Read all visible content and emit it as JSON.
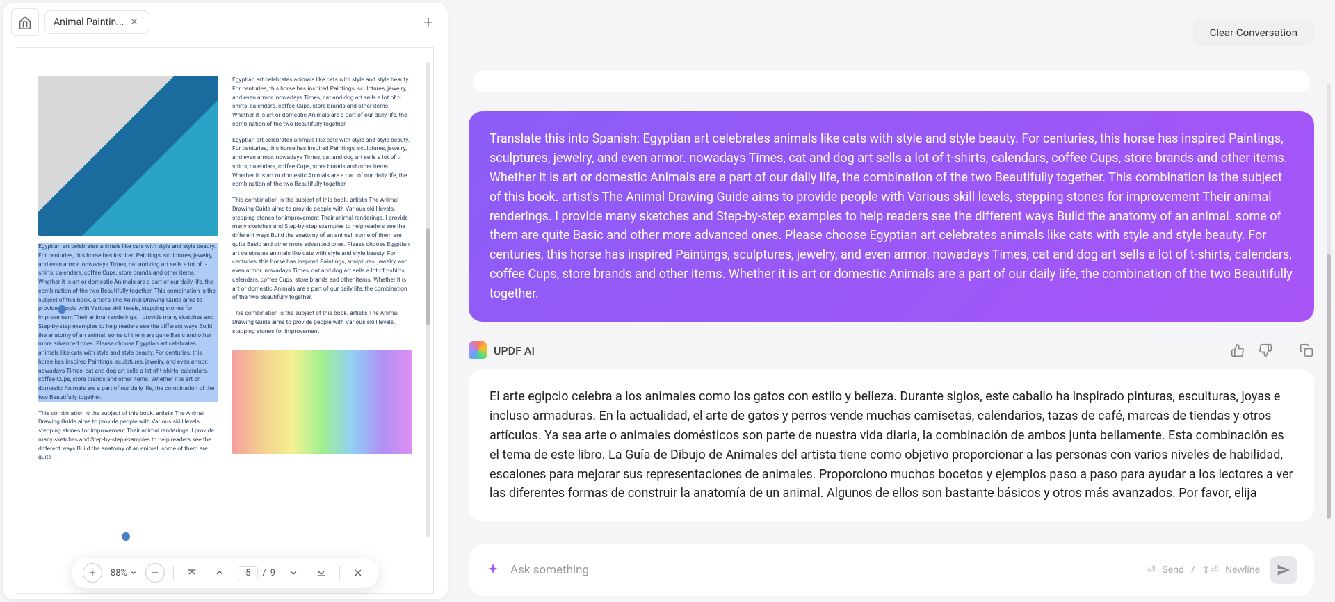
{
  "tab": {
    "title": "Animal Paintin...",
    "close_aria": "Close tab"
  },
  "add_tab_aria": "New tab",
  "toolbar": {
    "zoom": "88%",
    "page_current": "5",
    "page_sep": "/",
    "page_total": "9"
  },
  "doc_body": {
    "p1": "Egyptian art celebrates animals like cats with style and style beauty. For centuries, this horse has inspired Paintings, sculptures, jewelry, and even armor. nowadays Times, cat and dog art sells a lot of t-shirts, calendars, coffee Cups, store brands and other items. Whether it is art or domestic Animals are a part of our daily life, the combination of the two Beautifully together.",
    "p2": "Egyptian art celebrates animals like cats with style and style beauty. For centuries, this horse has inspired Paintings, sculptures, jewelry, and even armor. nowadays Times, cat and dog art sells a lot of t-shirts, calendars, coffee Cups, store brands and other items. Whether it is art or domestic Animals are a part of our daily life, the combination of the two Beautifully together. This combination is the subject of this book. artist's The Animal Drawing Guide aims to provide people with Various skill levels, stepping stones for improvement Their animal renderings. I provide many sketches and Step-by-step examples to help readers see the different ways Build the anatomy of an animal. some of them are quite Basic and other more advanced ones. Please choose Egyptian art celebrates animals like cats with style and style beauty. For centuries, this horse has inspired Paintings, sculptures, jewelry, and even armor. nowadays Times, cat and dog art sells a lot of t-shirts, calendars, coffee Cups, store brands and other items. Whether it is art or domestic Animals are a part of our daily life, the combination of the two Beautifully together.",
    "p3": "This combination is the subject of this book. artist's The Animal Drawing Guide aims to provide people with Various skill levels, stepping stones for improvement Their animal renderings. I provide many sketches and Step-by-step examples to help readers see the different ways Build the anatomy of an animal. some of them are quite",
    "p4": "Egyptian art celebrates animals like cats with style and style beauty. For centuries, this horse has inspired Paintings, sculptures, jewelry, and even armor. nowadays Times, cat and dog art sells a lot of t-shirts, calendars, coffee Cups, store brands and other items. Whether it is art or domestic Animals are a part of our daily life, the combination of the two Beautifully together.",
    "p5": "This combination is the subject of this book. artist's The Animal Drawing Guide aims to provide people with Various skill levels, stepping stones for improvement Their animal renderings. I provide many sketches and Step-by-step examples to help readers see the different ways Build the anatomy of an animal. some of them are quite Basic and other more advanced ones. Please choose Egyptian art celebrates animals like cats with style and style beauty. For centuries, this horse has inspired Paintings, sculptures, jewelry, and even armor. nowadays Times, cat and dog art sells a lot of t-shirts, calendars, coffee Cups, store brands and other items. Whether it is art or domestic Animals are a part of our daily life, the combination of the two Beautifully together.",
    "p6": "This combination is the subject of this book. artist's The Animal Drawing Guide aims to provide people with Various skill levels, stepping stones for improvement"
  },
  "clear_label": "Clear Conversation",
  "user_message": "Translate this into Spanish: Egyptian art celebrates animals like cats with style and style beauty. For centuries, this horse has inspired Paintings, sculptures, jewelry, and even armor. nowadays Times, cat and dog art sells a lot of t-shirts, calendars, coffee Cups, store brands and other items. Whether it is art or domestic Animals are a part of our daily life, the combination of the two Beautifully together. This combination is the subject of this book. artist's The Animal Drawing Guide aims to provide people with Various skill levels, stepping stones for improvement Their animal renderings. I provide many sketches and Step-by-step examples to help readers see the different ways Build the anatomy of an animal. some of them are quite Basic and other more advanced ones. Please choose Egyptian art celebrates animals like cats with style and style beauty. For centuries, this horse has inspired Paintings, sculptures, jewelry, and even armor. nowadays Times, cat and dog art sells a lot of t-shirts, calendars, coffee Cups, store brands and other items. Whether it is art or domestic Animals are a part of our daily life, the combination of the two Beautifully together.",
  "ai_name": "UPDF AI",
  "ai_message": "El arte egipcio celebra a los animales como los gatos con estilo y belleza. Durante siglos, este caballo ha inspirado pinturas, esculturas, joyas e incluso armaduras. En la actualidad, el arte de gatos y perros vende muchas camisetas, calendarios, tazas de café, marcas de tiendas y otros artículos. Ya sea arte o animales domésticos son parte de nuestra vida diaria, la combinación de ambos junta bellamente. Esta combinación es el tema de este libro. La Guía de Dibujo de Animales del artista tiene como objetivo proporcionar a las personas con varios niveles de habilidad, escalones para mejorar sus representaciones de animales. Proporciono muchos bocetos y ejemplos paso a paso para ayudar a los lectores a ver las diferentes formas de construir la anatomía de un animal. Algunos de ellos son bastante básicos y otros más avanzados. Por favor, elija",
  "input": {
    "placeholder": "Ask something",
    "send_hint": "Send",
    "newline_hint": "Newline",
    "sep": "/"
  }
}
